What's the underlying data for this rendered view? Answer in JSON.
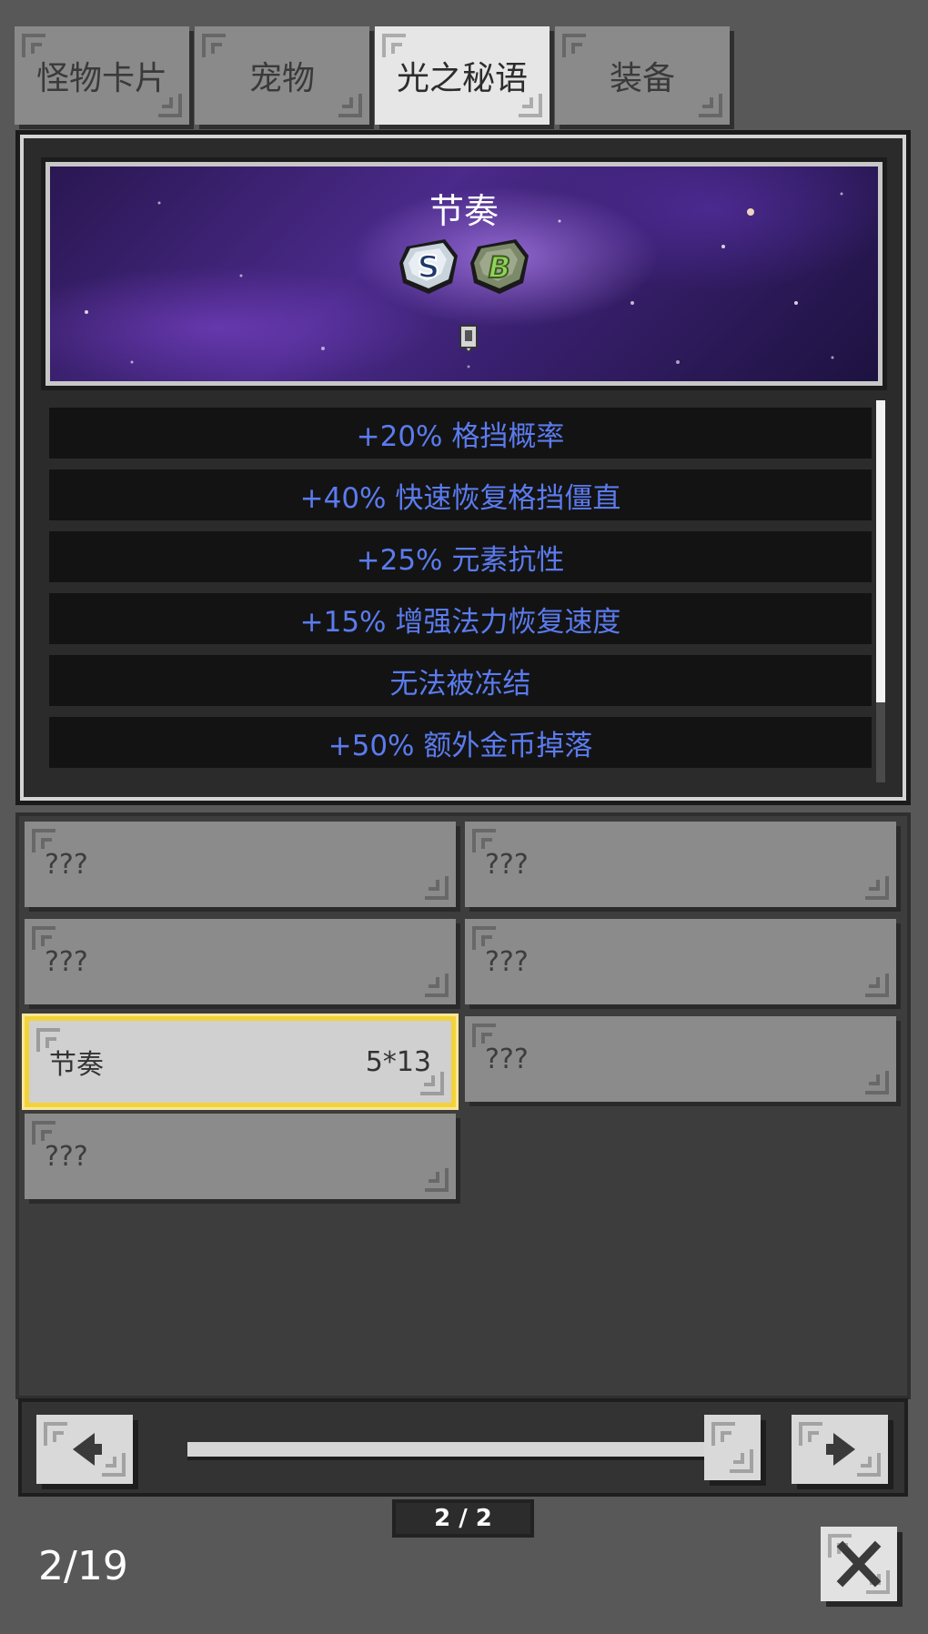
{
  "tabs": [
    {
      "label": "怪物卡片"
    },
    {
      "label": "宠物"
    },
    {
      "label": "光之秘语"
    },
    {
      "label": "装备"
    }
  ],
  "active_tab_index": 2,
  "detail": {
    "title": "节奏",
    "rune_badges": [
      {
        "letter": "S",
        "color": "#dfe6ee"
      },
      {
        "letter": "B",
        "color": "#8fd35a"
      }
    ],
    "stats": [
      "+20% 格挡概率",
      "+40% 快速恢复格挡僵直",
      "+25% 元素抗性",
      "+15% 增强法力恢复速度",
      "无法被冻结",
      "+50% 额外金币掉落"
    ],
    "scroll_fraction_visible": 0.79
  },
  "slots": [
    {
      "name": "???",
      "value": ""
    },
    {
      "name": "???",
      "value": ""
    },
    {
      "name": "???",
      "value": ""
    },
    {
      "name": "???",
      "value": ""
    },
    {
      "name": "节奏",
      "value": "5*13"
    },
    {
      "name": "???",
      "value": ""
    },
    {
      "name": "???",
      "value": ""
    }
  ],
  "selected_slot_index": 4,
  "pager": {
    "indicator": "2 / 2",
    "slider_fraction": 1.0
  },
  "footer": {
    "count": "2/19"
  },
  "colors": {
    "stat_text": "#5b7bee",
    "selection": "#f4d33a"
  },
  "icons": [
    "prev-arrow-icon",
    "next-arrow-icon",
    "close-icon",
    "rune-s-icon",
    "rune-b-icon",
    "socket-icon"
  ]
}
